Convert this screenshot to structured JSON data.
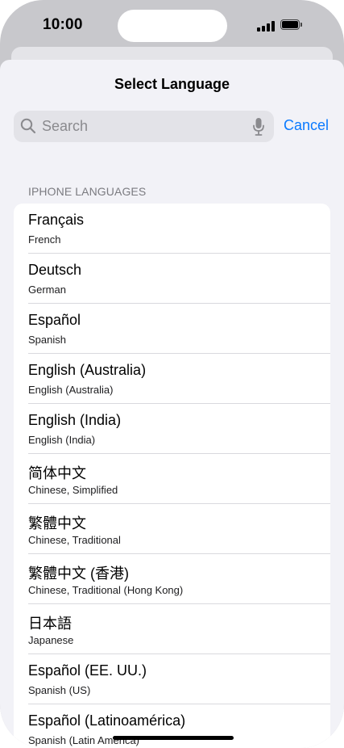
{
  "status_bar": {
    "time": "10:00"
  },
  "sheet": {
    "title": "Select Language",
    "search": {
      "placeholder": "Search"
    },
    "cancel_label": "Cancel",
    "section_header": "IPHONE LANGUAGES",
    "languages": [
      {
        "native": "Français",
        "english": "French"
      },
      {
        "native": "Deutsch",
        "english": "German"
      },
      {
        "native": "Español",
        "english": "Spanish"
      },
      {
        "native": "English (Australia)",
        "english": "English (Australia)"
      },
      {
        "native": "English (India)",
        "english": "English (India)"
      },
      {
        "native": "简体中文",
        "english": "Chinese, Simplified"
      },
      {
        "native": "繁體中文",
        "english": "Chinese, Traditional"
      },
      {
        "native": "繁體中文 (香港)",
        "english": "Chinese, Traditional (Hong Kong)"
      },
      {
        "native": "日本語",
        "english": "Japanese"
      },
      {
        "native": "Español (EE. UU.)",
        "english": "Spanish (US)"
      },
      {
        "native": "Español (Latinoamérica)",
        "english": "Spanish (Latin America)"
      }
    ]
  },
  "colors": {
    "accent": "#0a7aff",
    "sheet_background": "#f2f2f7",
    "frame": "#c8c8cc"
  }
}
